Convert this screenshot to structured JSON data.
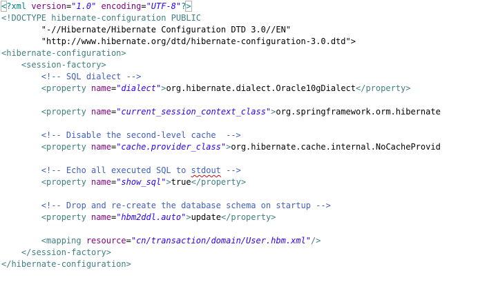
{
  "editor": {
    "lines": [
      [
        {
          "t": "<",
          "c": "pi",
          "box": true
        },
        {
          "t": "?xml ",
          "c": "pi"
        },
        {
          "t": "version",
          "c": "attr"
        },
        {
          "t": "=",
          "c": "text"
        },
        {
          "t": "\"1.0\"",
          "c": "val"
        },
        {
          "t": " ",
          "c": "text"
        },
        {
          "t": "encoding",
          "c": "attr"
        },
        {
          "t": "=",
          "c": "text"
        },
        {
          "t": "\"UTF-8\"",
          "c": "val"
        },
        {
          "t": "?",
          "c": "pi"
        },
        {
          "t": ">",
          "c": "pi",
          "box": true
        }
      ],
      [
        {
          "t": "<!DOCTYPE hibernate-configuration ",
          "c": "tag"
        },
        {
          "t": "PUBLIC",
          "c": "tag"
        }
      ],
      [
        {
          "t": "        ",
          "c": "text"
        },
        {
          "t": "\"-//Hibernate/Hibernate Configuration DTD 3.0//EN\"",
          "c": "text"
        }
      ],
      [
        {
          "t": "        ",
          "c": "text"
        },
        {
          "t": "\"http://www.hibernate.org/dtd/hibernate-configuration-3.0.dtd\">",
          "c": "text"
        }
      ],
      [
        {
          "t": "<hibernate-configuration>",
          "c": "tag"
        }
      ],
      [
        {
          "t": "    ",
          "c": "text"
        },
        {
          "t": "<session-factory>",
          "c": "tag"
        }
      ],
      [
        {
          "t": "        ",
          "c": "text"
        },
        {
          "t": "<!-- SQL dialect -->",
          "c": "com"
        }
      ],
      [
        {
          "t": "        ",
          "c": "text"
        },
        {
          "t": "<property ",
          "c": "tag"
        },
        {
          "t": "name",
          "c": "attr"
        },
        {
          "t": "=",
          "c": "text"
        },
        {
          "t": "\"dialect\"",
          "c": "val"
        },
        {
          "t": ">",
          "c": "tag"
        },
        {
          "t": "org.hibernate.dialect.Oracle10gDialect",
          "c": "text"
        },
        {
          "t": "</property>",
          "c": "tag"
        }
      ],
      [],
      [
        {
          "t": "        ",
          "c": "text"
        },
        {
          "t": "<property ",
          "c": "tag"
        },
        {
          "t": "name",
          "c": "attr"
        },
        {
          "t": "=",
          "c": "text"
        },
        {
          "t": "\"current_session_context_class\"",
          "c": "val"
        },
        {
          "t": ">",
          "c": "tag"
        },
        {
          "t": "org.springframework.orm.hibernate",
          "c": "text"
        }
      ],
      [],
      [
        {
          "t": "        ",
          "c": "text"
        },
        {
          "t": "<!-- Disable the second-level cache  -->",
          "c": "com"
        }
      ],
      [
        {
          "t": "        ",
          "c": "text"
        },
        {
          "t": "<property ",
          "c": "tag"
        },
        {
          "t": "name",
          "c": "attr"
        },
        {
          "t": "=",
          "c": "text"
        },
        {
          "t": "\"cache.provider_class\"",
          "c": "val"
        },
        {
          "t": ">",
          "c": "tag"
        },
        {
          "t": "org.hibernate.cache.internal.NoCacheProvid",
          "c": "text"
        }
      ],
      [],
      [
        {
          "t": "        ",
          "c": "text"
        },
        {
          "t": "<!-- Echo all executed SQL to ",
          "c": "com"
        },
        {
          "t": "stdout",
          "c": "com",
          "squiggle": true
        },
        {
          "t": " -->",
          "c": "com"
        }
      ],
      [
        {
          "t": "        ",
          "c": "text"
        },
        {
          "t": "<property ",
          "c": "tag"
        },
        {
          "t": "name",
          "c": "attr"
        },
        {
          "t": "=",
          "c": "text"
        },
        {
          "t": "\"show_sql\"",
          "c": "val"
        },
        {
          "t": ">",
          "c": "tag"
        },
        {
          "t": "true",
          "c": "text"
        },
        {
          "t": "</property>",
          "c": "tag"
        }
      ],
      [],
      [
        {
          "t": "        ",
          "c": "text"
        },
        {
          "t": "<!-- Drop and re-create the database schema on startup -->",
          "c": "com"
        }
      ],
      [
        {
          "t": "        ",
          "c": "text"
        },
        {
          "t": "<property ",
          "c": "tag"
        },
        {
          "t": "name",
          "c": "attr"
        },
        {
          "t": "=",
          "c": "text"
        },
        {
          "t": "\"hbm2ddl.auto\"",
          "c": "val"
        },
        {
          "t": ">",
          "c": "tag"
        },
        {
          "t": "update",
          "c": "text"
        },
        {
          "t": "</property>",
          "c": "tag"
        }
      ],
      [],
      [
        {
          "t": "        ",
          "c": "text"
        },
        {
          "t": "<mapping ",
          "c": "tag"
        },
        {
          "t": "resource",
          "c": "attr"
        },
        {
          "t": "=",
          "c": "text"
        },
        {
          "t": "\"cn/transaction/domain/User.hbm.xml\"",
          "c": "val"
        },
        {
          "t": "/>",
          "c": "tag"
        }
      ],
      [
        {
          "t": "    ",
          "c": "text"
        },
        {
          "t": "</session-factory>",
          "c": "tag"
        }
      ],
      [
        {
          "t": "</hibernate-configuration>",
          "c": "tag"
        }
      ]
    ],
    "colors": {
      "tag": "#3f7f7f",
      "attribute": "#7f007f",
      "value": "#2a00ff",
      "comment": "#3f5fbf",
      "text": "#000000",
      "spellcheck": "#d00000"
    }
  }
}
